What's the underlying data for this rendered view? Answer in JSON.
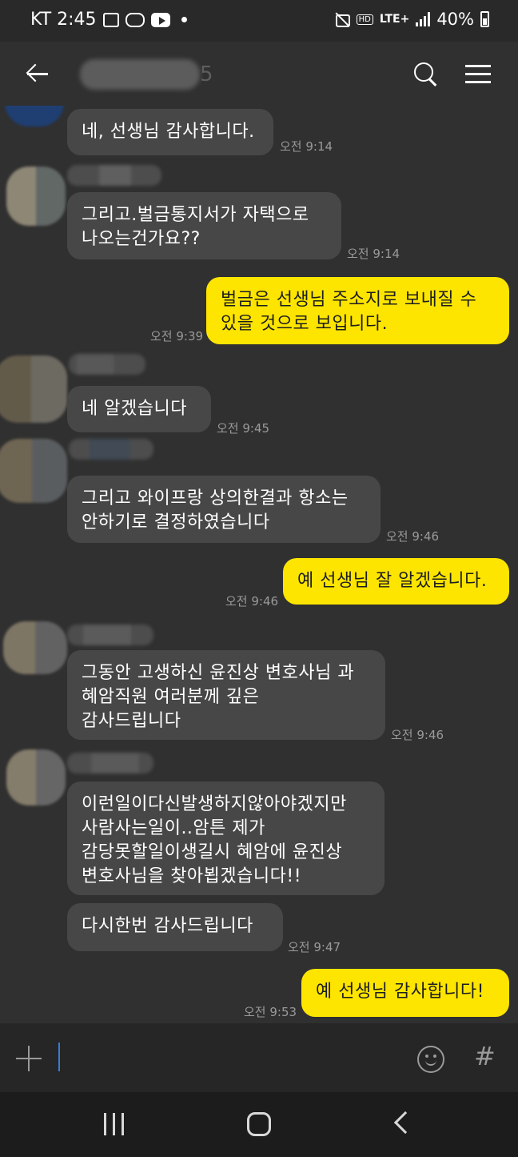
{
  "status_bar": {
    "carrier_time": "KT 2:45",
    "hd": "HD",
    "lte": "LTE+",
    "battery": "40%",
    "icons": [
      "gallery-icon",
      "voicemail-icon",
      "youtube-icon",
      "mute-icon",
      "signal-icon",
      "battery-icon"
    ]
  },
  "header": {
    "title_visible": "5",
    "icons": [
      "back-arrow-icon",
      "search-icon",
      "menu-icon"
    ]
  },
  "messages": [
    {
      "side": "in",
      "text": "네, 선생님 감사합니다.",
      "time": "오전 9:14"
    },
    {
      "side": "in",
      "text": "그리고.벌금통지서가 자택으로\n나오는건가요??",
      "time": "오전 9:14"
    },
    {
      "side": "out",
      "text": "벌금은 선생님 주소지로 보내질 수\n있을 것으로 보입니다.",
      "time": "오전 9:39"
    },
    {
      "side": "in",
      "text": "네 알겠습니다",
      "time": "오전 9:45"
    },
    {
      "side": "in",
      "text": "그리고 와이프랑 상의한결과 항소는\n안하기로 결정하였습니다",
      "time": "오전 9:46"
    },
    {
      "side": "out",
      "text": "예 선생님 잘 알겠습니다.",
      "time": "오전 9:46"
    },
    {
      "side": "in",
      "text": "그동안 고생하신 윤진상 변호사님 과\n혜암직원 여러분께 깊은\n감사드립니다",
      "time": "오전 9:46"
    },
    {
      "side": "in",
      "text": "이런일이다신발생하지않아야겠지만\n사람사는일이..암튼 제가\n감당못할일이생길시 혜암에 윤진상\n변호사님을 찾아뵙겠습니다!!",
      "time": ""
    },
    {
      "side": "in",
      "text": "다시한번 감사드립니다",
      "time": "오전 9:47"
    },
    {
      "side": "out",
      "text": "예 선생님 감사합니다!",
      "time": "오전 9:53"
    }
  ],
  "input": {
    "value": "",
    "plus_icon": "plus-icon",
    "emoji_icon": "emoji-icon",
    "hash_label": "#"
  },
  "nav": {
    "icons": [
      "recent-apps-icon",
      "home-icon",
      "back-icon"
    ]
  },
  "colors": {
    "background": "#303030",
    "incoming_bubble": "#474747",
    "outgoing_bubble": "#fee500",
    "time_text": "#9a9a9a"
  }
}
